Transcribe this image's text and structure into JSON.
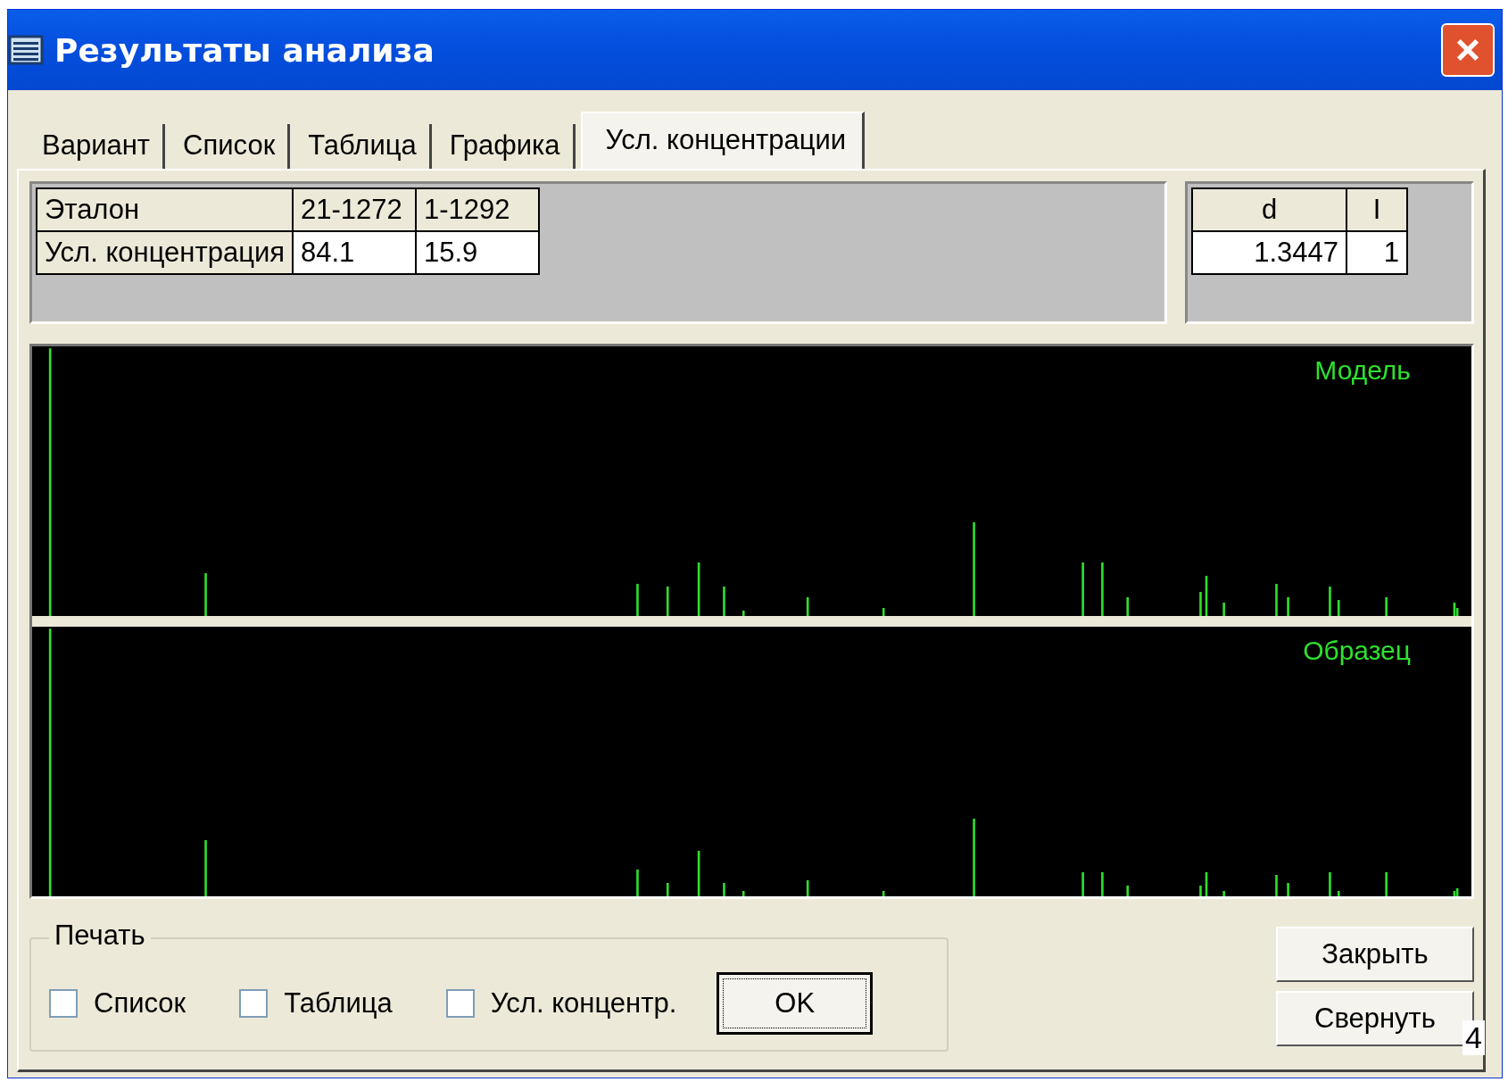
{
  "window": {
    "title": "Результаты анализа"
  },
  "tabs": [
    {
      "label": "Вариант",
      "selected": false
    },
    {
      "label": "Список",
      "selected": false
    },
    {
      "label": "Таблица",
      "selected": false
    },
    {
      "label": "Графика",
      "selected": false
    },
    {
      "label": "Усл. концентрации",
      "selected": true
    }
  ],
  "concentration_table": {
    "rows": [
      {
        "header": "Эталон",
        "cells": [
          "21-1272",
          "1-1292"
        ],
        "kind": "head"
      },
      {
        "header": "Усл. концентрация",
        "cells": [
          "84.1",
          "15.9"
        ],
        "kind": "value"
      }
    ]
  },
  "line_table": {
    "columns": [
      "d",
      "I"
    ],
    "row": [
      "1.3447",
      "1"
    ]
  },
  "charts": [
    {
      "label": "Модель"
    },
    {
      "label": "Образец"
    }
  ],
  "print_group": {
    "title": "Печать",
    "options": [
      {
        "label": "Список",
        "checked": false
      },
      {
        "label": "Таблица",
        "checked": false
      },
      {
        "label": "Усл. концентр.",
        "checked": false
      }
    ],
    "ok_button": "OK"
  },
  "buttons": [
    "Закрыть",
    "Свернуть"
  ],
  "page_number": "4"
}
